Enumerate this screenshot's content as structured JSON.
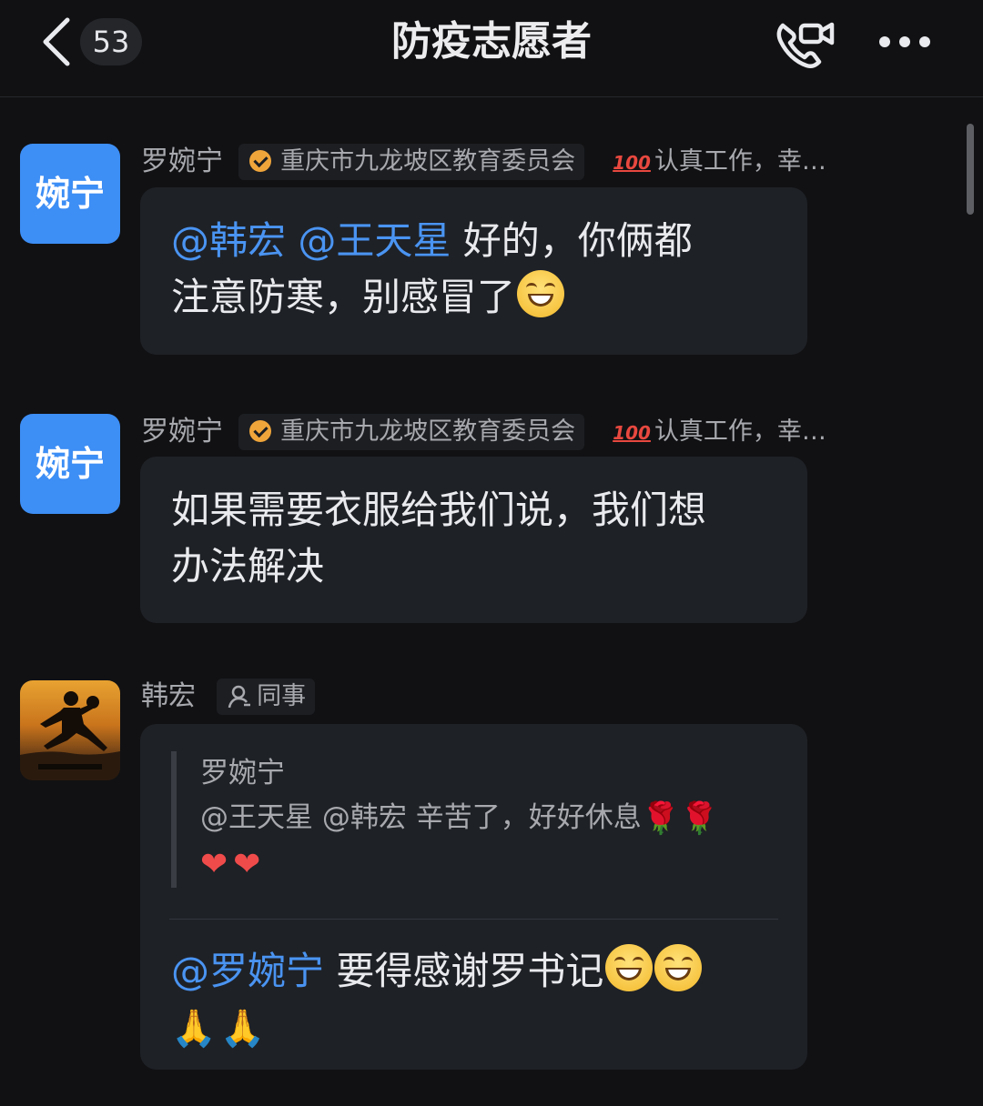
{
  "header": {
    "unread_count": "53",
    "title": "防疫志愿者"
  },
  "messages": [
    {
      "avatar_text": "婉宁",
      "sender": "罗婉宁",
      "org": "重庆市九龙坡区教育委员会",
      "status": "认真工作，幸…",
      "mentions": [
        "@韩宏",
        "@王天星"
      ],
      "text_line1": "好的，你俩都",
      "text_line2": "注意防寒，别感冒了"
    },
    {
      "avatar_text": "婉宁",
      "sender": "罗婉宁",
      "org": "重庆市九龙坡区教育委员会",
      "status": "认真工作，幸…",
      "text_line1": "如果需要衣服给我们说，我们想",
      "text_line2": "办法解决"
    },
    {
      "sender": "韩宏",
      "role": "同事",
      "quote_sender": "罗婉宁",
      "quote_text": "@王天星 @韩宏 辛苦了，好好休息",
      "mention": "@罗婉宁",
      "text": "要得感谢罗书记"
    }
  ],
  "emoji": {
    "status_prefix": "100",
    "rose": "🌹",
    "heart": "❤",
    "hands": "🙏"
  },
  "colors": {
    "background": "#111113",
    "bubble": "#1e2126",
    "mention": "#4a94f2",
    "avatar": "#3d8ef5"
  }
}
